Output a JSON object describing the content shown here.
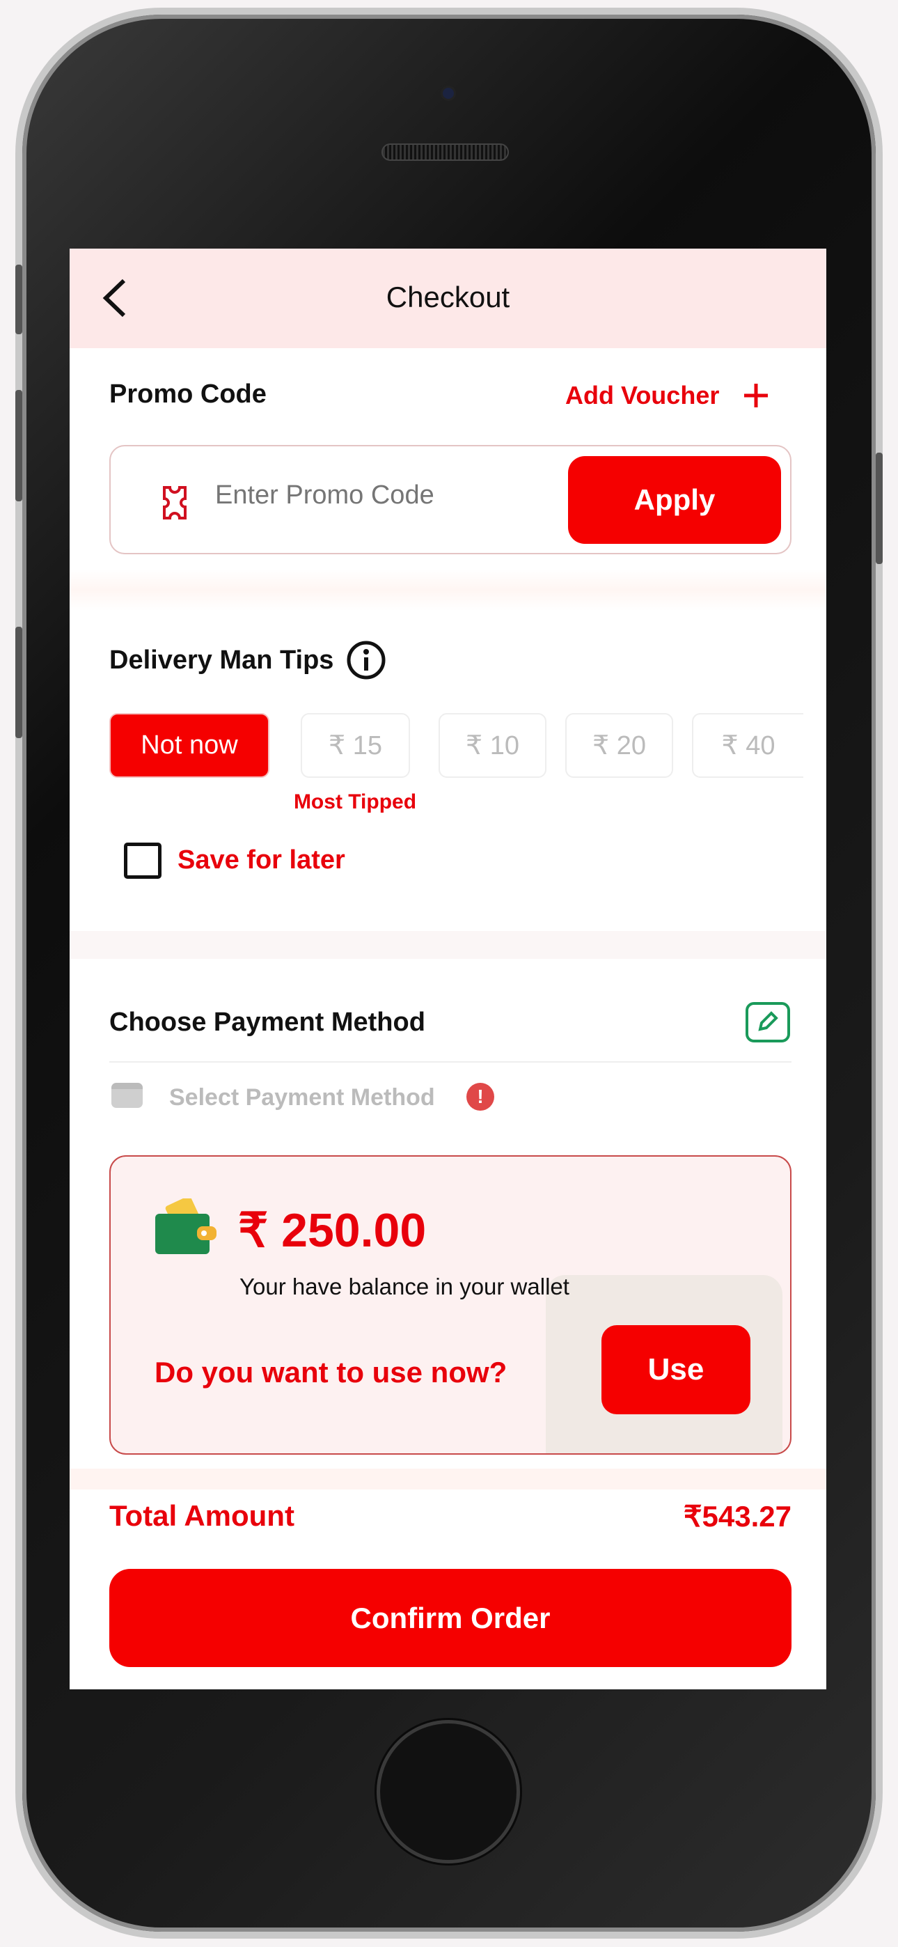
{
  "header": {
    "title": "Checkout",
    "back_icon": "chevron-left-icon"
  },
  "promo": {
    "title": "Promo Code",
    "add_voucher": "Add Voucher",
    "placeholder": "Enter Promo Code",
    "apply": "Apply"
  },
  "tips": {
    "title": "Delivery Man Tips",
    "options": [
      "Not now",
      "₹ 15",
      "₹ 10",
      "₹ 20",
      "₹ 40"
    ],
    "selected": "Not now",
    "most_tipped": "Most Tipped",
    "save_for_later": "Save for later",
    "save_checked": false
  },
  "payment": {
    "title": "Choose Payment Method",
    "select_placeholder": "Select Payment Method"
  },
  "wallet": {
    "amount": "₹ 250.00",
    "balance_text": "Your have balance in your wallet",
    "question": "Do you want to use now?",
    "use": "Use"
  },
  "total": {
    "label": "Total Amount",
    "value": "₹543.27"
  },
  "confirm": "Confirm Order",
  "colors": {
    "accent": "#f50000",
    "header_bg": "#fde8e8",
    "edit_icon": "#1a9a5a"
  }
}
